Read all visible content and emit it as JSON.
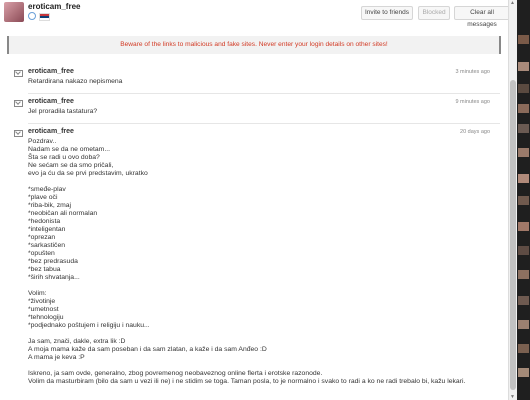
{
  "header": {
    "username": "eroticam_free",
    "buttons": {
      "invite": "Invite to friends",
      "blocked": "Blocked",
      "clear": "Clear all messages"
    }
  },
  "warning": "Beware of the links to malicious and fake sites. Never enter your login details on other sites!",
  "messages": [
    {
      "author": "eroticam_free",
      "time": "3 minutes ago",
      "lines": [
        "Retardirana nakazo nepismena"
      ]
    },
    {
      "author": "eroticam_free",
      "time": "9 minutes ago",
      "lines": [
        "Jel proradila tastatura?"
      ]
    },
    {
      "author": "eroticam_free",
      "time": "20 days ago",
      "lines": [
        "Pozdrav..",
        "Nadam se da ne ometam...",
        "Šta se radi u ovo doba?",
        "Ne sećam se da smo pričali,",
        "evo ja ću da se prvi predstavim, ukratko",
        "",
        "*smeđe-plav",
        "*plave oči",
        "*riba-bik, zmaj",
        "*neobičan ali normalan",
        "*hedonista",
        "*inteligentan",
        "*oprezan",
        "*sarkastičen",
        "*opušten",
        "*bez predrasuda",
        "*bez tabua",
        "*širih shvatanja...",
        "",
        "Volim:",
        "*životinje",
        "*umetnost",
        "*tehnologiju",
        "*podjednako poštujem i religiju i nauku...",
        "",
        "Ja sam, znači, dakle, extra lik :D",
        "A moja mama kaže da sam poseban i da sam zlatan, a kaže i da sam Anđeo :D",
        "A mama je keva :P",
        "",
        "Iskreno, ja sam ovde, generalno, zbog povremenog neobaveznog online flerta i erotske razonode.",
        "Volim da masturbiram (bilo da sam u vezi ili ne) i ne stidim se toga. Taman posla, to je normalno i svako to radi a ko ne radi trebalo bi, kažu lekari."
      ]
    }
  ]
}
